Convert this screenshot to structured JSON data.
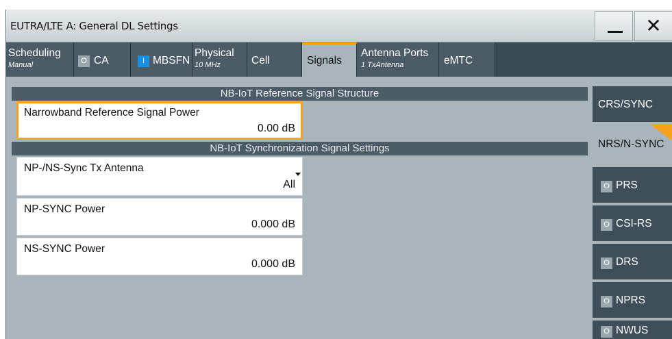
{
  "window": {
    "title": "EUTRA/LTE A: General DL Settings",
    "minimize_label": "—",
    "close_label": "✕"
  },
  "tabs": [
    {
      "label": "Scheduling",
      "sub": "Manual"
    },
    {
      "label": "CA",
      "toggle": "O"
    },
    {
      "label": "MBSFN",
      "toggle": "I"
    },
    {
      "label": "Physical",
      "sub": "10 MHz"
    },
    {
      "label": "Cell"
    },
    {
      "label": "Signals",
      "active": true
    },
    {
      "label": "Antenna Ports",
      "sub": "1 TxAntenna"
    },
    {
      "label": "eMTC"
    }
  ],
  "main": {
    "section1": {
      "title": "NB-IoT Reference Signal Structure",
      "fields": [
        {
          "label": "Narrowband Reference Signal Power",
          "value": "0.00 dB"
        }
      ]
    },
    "section2": {
      "title": "NB-IoT Synchronization Signal Settings",
      "fields": [
        {
          "label": "NP-/NS-Sync Tx Antenna",
          "value": "All"
        },
        {
          "label": "NP-SYNC Power",
          "value": "0.000 dB"
        },
        {
          "label": "NS-SYNC Power",
          "value": "0.000 dB"
        }
      ]
    }
  },
  "sidenav": [
    {
      "label": "CRS/SYNC"
    },
    {
      "label": "NRS/N-SYNC",
      "active": true
    },
    {
      "label": "PRS",
      "toggle": "O"
    },
    {
      "label": "CSI-RS",
      "toggle": "O"
    },
    {
      "label": "DRS",
      "toggle": "O"
    },
    {
      "label": "NPRS",
      "toggle": "O"
    },
    {
      "label": "NWUS",
      "toggle": "O"
    }
  ],
  "colors": {
    "accent": "#f7a21a",
    "toggle_on": "#1a8fe0",
    "panel_bg": "#a9b5bb",
    "header_bg": "#4c5c66"
  }
}
